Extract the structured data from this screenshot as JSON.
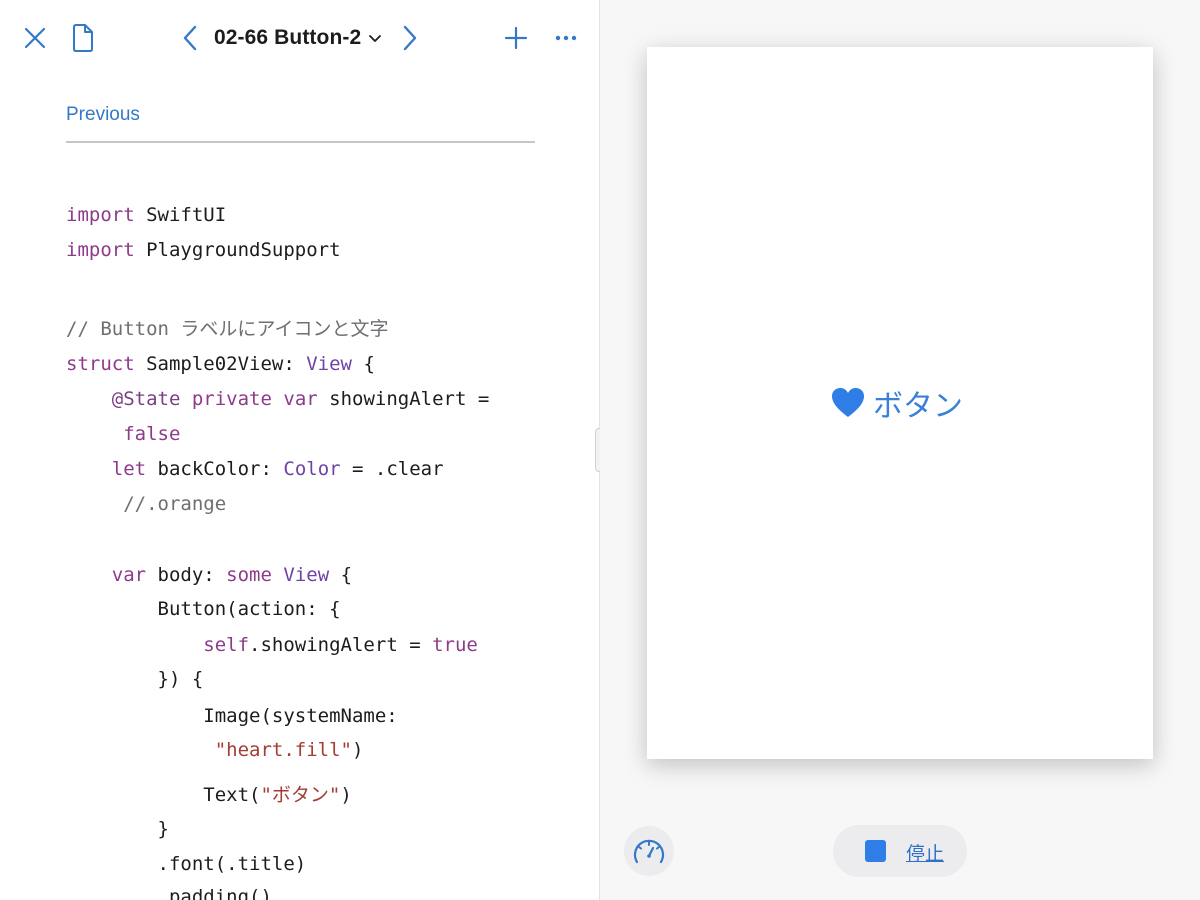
{
  "colors": {
    "accent": "#3478c6",
    "keyword": "#8e3a8a",
    "type": "#6f42a5",
    "string": "#a23e33",
    "comment": "#6e6e73",
    "stop_square": "#2f7de6",
    "heart": "#2f7de6"
  },
  "toolbar": {
    "close_icon": "close-icon",
    "document_icon": "document-icon",
    "prev_icon": "chevron-left-icon",
    "title": "02-66 Button-2",
    "title_menu_icon": "chevron-down-icon",
    "next_icon": "chevron-right-icon",
    "add_icon": "plus-icon",
    "more_icon": "ellipsis-icon"
  },
  "editor": {
    "previous_link": "Previous",
    "code_lines": [
      [
        {
          "t": "import",
          "c": "kw"
        },
        {
          "t": " SwiftUI"
        }
      ],
      [
        {
          "t": "import",
          "c": "kw"
        },
        {
          "t": " PlaygroundSupport"
        }
      ],
      [
        {
          "t": "// Button ラベルにアイコンと文字",
          "c": "cm"
        }
      ],
      [
        {
          "t": "struct",
          "c": "kw"
        },
        {
          "t": " Sample02View: "
        },
        {
          "t": "View",
          "c": "ty"
        },
        {
          "t": " {"
        }
      ],
      [
        {
          "t": "    "
        },
        {
          "t": "@State",
          "c": "at"
        },
        {
          "t": " "
        },
        {
          "t": "private",
          "c": "kw"
        },
        {
          "t": " "
        },
        {
          "t": "var",
          "c": "kw"
        },
        {
          "t": " showingAlert ="
        }
      ],
      [
        {
          "t": "     "
        },
        {
          "t": "false",
          "c": "kw"
        }
      ],
      [
        {
          "t": "    "
        },
        {
          "t": "let",
          "c": "kw"
        },
        {
          "t": " backColor: "
        },
        {
          "t": "Color",
          "c": "ty"
        },
        {
          "t": " = .clear"
        }
      ],
      [
        {
          "t": "     //.orange",
          "c": "cm"
        }
      ],
      [
        {
          "t": "    "
        },
        {
          "t": "var",
          "c": "kw"
        },
        {
          "t": " body: "
        },
        {
          "t": "some",
          "c": "kw"
        },
        {
          "t": " "
        },
        {
          "t": "View",
          "c": "ty"
        },
        {
          "t": " {"
        }
      ],
      [
        {
          "t": "        Button(action: {"
        }
      ],
      [
        {
          "t": "            "
        },
        {
          "t": "self",
          "c": "kw"
        },
        {
          "t": ".showingAlert = "
        },
        {
          "t": "true",
          "c": "kw"
        }
      ],
      [
        {
          "t": "        }) {"
        }
      ],
      [
        {
          "t": "            Image(systemName:"
        }
      ],
      [
        {
          "t": "             "
        },
        {
          "t": "\"heart.fill\"",
          "c": "str"
        },
        {
          "t": ")"
        }
      ],
      [
        {
          "t": "            Text("
        },
        {
          "t": "\"ボタン\"",
          "c": "str"
        },
        {
          "t": ")"
        }
      ],
      [
        {
          "t": "        }"
        }
      ],
      [
        {
          "t": "        .font(.title)"
        }
      ],
      [
        {
          "t": "        .padding()"
        }
      ]
    ]
  },
  "live_view": {
    "button_icon": "heart-fill-icon",
    "button_label": "ボタン",
    "speed_icon": "speedometer-icon",
    "stop_icon": "stop-icon",
    "stop_label": "停止"
  }
}
